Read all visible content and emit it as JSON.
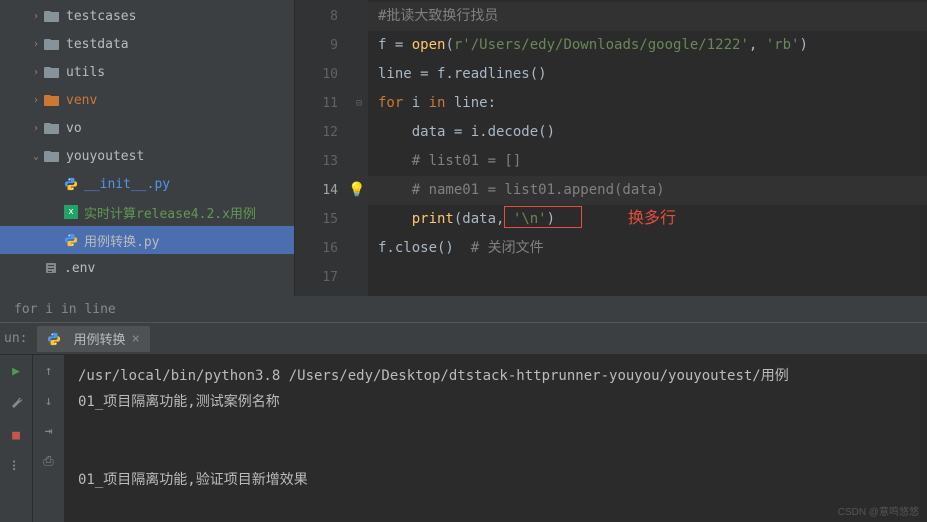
{
  "sidebar": {
    "items": [
      {
        "label": "testcases",
        "type": "folder",
        "expanded": false,
        "indent": 1
      },
      {
        "label": "testdata",
        "type": "folder",
        "expanded": false,
        "indent": 1
      },
      {
        "label": "utils",
        "type": "folder",
        "expanded": false,
        "indent": 1
      },
      {
        "label": "venv",
        "type": "folder-lib",
        "expanded": false,
        "indent": 1
      },
      {
        "label": "vo",
        "type": "folder",
        "expanded": false,
        "indent": 1
      },
      {
        "label": "youyoutest",
        "type": "folder",
        "expanded": true,
        "indent": 1
      },
      {
        "label": "__init__.py",
        "type": "python",
        "indent": 2
      },
      {
        "label": "实时计算release4.2.x用例",
        "type": "excel",
        "indent": 2
      },
      {
        "label": "用例转换.py",
        "type": "python",
        "indent": 2,
        "selected": true
      },
      {
        "label": ".env",
        "type": "env",
        "indent": 1
      }
    ]
  },
  "editor": {
    "lines": [
      {
        "num": "8",
        "tokens": [
          {
            "t": "#批读大致换行找员",
            "c": "cmt"
          }
        ],
        "hl": true
      },
      {
        "num": "9",
        "tokens": [
          {
            "t": "f = ",
            "c": ""
          },
          {
            "t": "open",
            "c": "fn"
          },
          {
            "t": "(",
            "c": ""
          },
          {
            "t": "r'/Users/edy/Downloads/google/1222'",
            "c": "str"
          },
          {
            "t": ", ",
            "c": ""
          },
          {
            "t": "'rb'",
            "c": "str"
          },
          {
            "t": ")",
            "c": ""
          }
        ]
      },
      {
        "num": "10",
        "tokens": [
          {
            "t": "line = f.readlines()",
            "c": ""
          }
        ]
      },
      {
        "num": "11",
        "tokens": [
          {
            "t": "for ",
            "c": "kw"
          },
          {
            "t": "i ",
            "c": ""
          },
          {
            "t": "in ",
            "c": "kw"
          },
          {
            "t": "line:",
            "c": ""
          }
        ],
        "fold": "-"
      },
      {
        "num": "12",
        "tokens": [
          {
            "t": "    data = i.decode()",
            "c": ""
          }
        ]
      },
      {
        "num": "13",
        "tokens": [
          {
            "t": "    ",
            "c": ""
          },
          {
            "t": "# list01 = []",
            "c": "cmt"
          }
        ]
      },
      {
        "num": "14",
        "tokens": [
          {
            "t": "    ",
            "c": ""
          },
          {
            "t": "# name01 = list01.append(data)",
            "c": "cmt"
          }
        ],
        "bulb": true,
        "caret": true
      },
      {
        "num": "15",
        "tokens": [
          {
            "t": "    ",
            "c": ""
          },
          {
            "t": "print",
            "c": "fn"
          },
          {
            "t": "(data",
            "c": ""
          },
          {
            "t": ", ",
            "c": ""
          },
          {
            "t": "'\\n'",
            "c": "str"
          },
          {
            "t": ")",
            "c": ""
          }
        ]
      },
      {
        "num": "16",
        "tokens": [
          {
            "t": "f.close()  ",
            "c": ""
          },
          {
            "t": "# 关闭文件",
            "c": "cmt"
          }
        ]
      },
      {
        "num": "17",
        "tokens": [
          {
            "t": "",
            "c": ""
          }
        ]
      }
    ],
    "annotation": "换多行",
    "breadcrumb": "for i in line"
  },
  "run": {
    "panel_label": "un:",
    "tab_name": "用例转换",
    "output": [
      "/usr/local/bin/python3.8 /Users/edy/Desktop/dtstack-httprunner-youyou/youyoutest/用例",
      "01_项目隔离功能,测试案例名称",
      "",
      "",
      "01_项目隔离功能,验证项目新增效果"
    ]
  },
  "watermark": "CSDN @意鸣悠悠"
}
